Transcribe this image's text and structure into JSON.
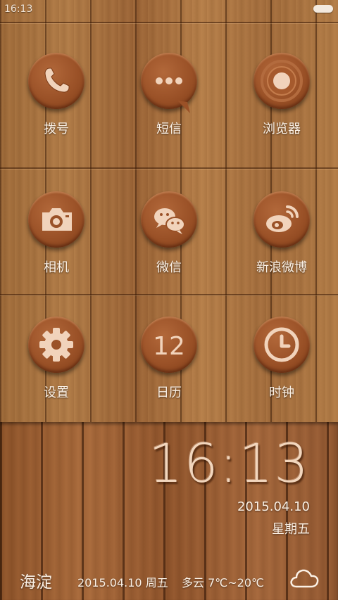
{
  "status_bar": {
    "time": "16:13"
  },
  "apps": [
    {
      "label": "拨号",
      "icon": "phone-icon"
    },
    {
      "label": "短信",
      "icon": "message-icon"
    },
    {
      "label": "浏览器",
      "icon": "browser-icon"
    },
    {
      "label": "相机",
      "icon": "camera-icon"
    },
    {
      "label": "微信",
      "icon": "wechat-icon"
    },
    {
      "label": "新浪微博",
      "icon": "weibo-icon"
    },
    {
      "label": "设置",
      "icon": "gear-icon"
    },
    {
      "label": "日历",
      "icon": "calendar-icon",
      "glyph": "12"
    },
    {
      "label": "时钟",
      "icon": "clock-icon"
    }
  ],
  "clock_widget": {
    "time": "16:13",
    "date": "2015.04.10",
    "weekday": "星期五"
  },
  "weather": {
    "city": "海淀",
    "date": "2015.04.10 周五",
    "condition": "多云 7℃~20℃",
    "icon": "cloud-icon"
  },
  "colors": {
    "wood": "#a8703e",
    "icon_disc": "#9a5127",
    "icon_glyph": "#f1d3bb",
    "label": "#fbf1e6"
  }
}
